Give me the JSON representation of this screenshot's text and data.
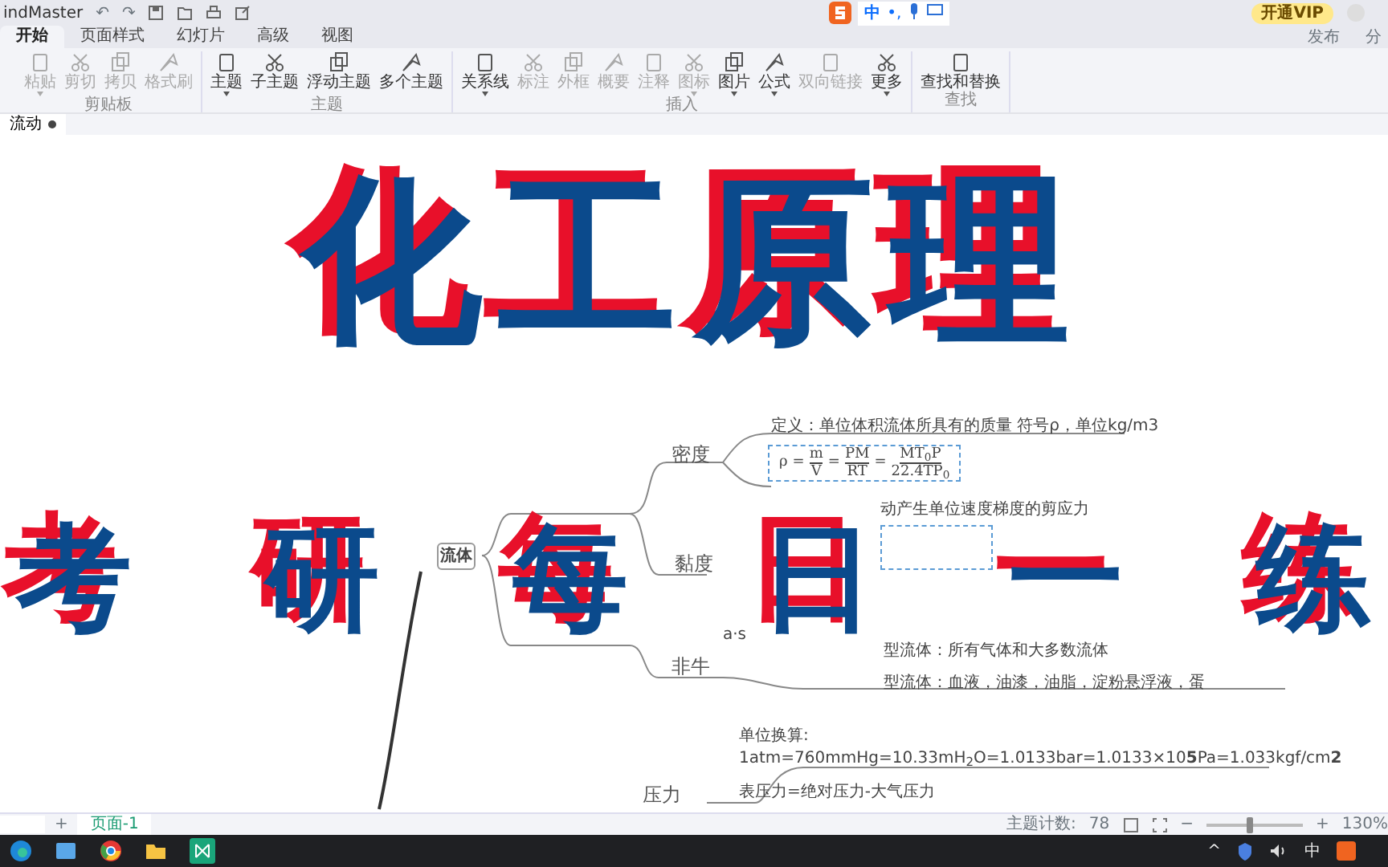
{
  "window": {
    "title": "indMaster",
    "quick_actions": [
      "↶",
      "↷"
    ]
  },
  "ime_bar": {
    "labels": [
      "中",
      "•,"
    ]
  },
  "account": {
    "vip": "开通VIP",
    "actions": [
      "发布",
      "分"
    ]
  },
  "tabs": [
    {
      "label": "开始",
      "selected": true
    },
    {
      "label": "页面样式",
      "selected": false
    },
    {
      "label": "幻灯片",
      "selected": false
    },
    {
      "label": "高级",
      "selected": false
    },
    {
      "label": "视图",
      "selected": false
    }
  ],
  "ribbon": [
    {
      "group": "剪贴板",
      "buttons": [
        {
          "label": "粘贴",
          "disabled": true,
          "dropdown": true
        },
        {
          "label": "剪切",
          "disabled": true,
          "dropdown": false
        },
        {
          "label": "拷贝",
          "disabled": true,
          "dropdown": false
        },
        {
          "label": "格式刷",
          "disabled": true,
          "dropdown": false
        }
      ]
    },
    {
      "group": "主题",
      "buttons": [
        {
          "label": "主题",
          "disabled": false,
          "dropdown": true
        },
        {
          "label": "子主题",
          "disabled": false,
          "dropdown": false
        },
        {
          "label": "浮动主题",
          "disabled": false,
          "dropdown": false
        },
        {
          "label": "多个主题",
          "disabled": false,
          "dropdown": false
        }
      ]
    },
    {
      "group": "插入",
      "buttons": [
        {
          "label": "关系线",
          "disabled": false,
          "dropdown": true
        },
        {
          "label": "标注",
          "disabled": true,
          "dropdown": false
        },
        {
          "label": "外框",
          "disabled": true,
          "dropdown": false
        },
        {
          "label": "概要",
          "disabled": true,
          "dropdown": false
        },
        {
          "label": "注释",
          "disabled": true,
          "dropdown": false
        },
        {
          "label": "图标",
          "disabled": true,
          "dropdown": true
        },
        {
          "label": "图片",
          "disabled": false,
          "dropdown": true
        },
        {
          "label": "公式",
          "disabled": false,
          "dropdown": true
        },
        {
          "label": "双向链接",
          "disabled": true,
          "dropdown": false
        },
        {
          "label": "更多",
          "disabled": false,
          "dropdown": true
        }
      ]
    },
    {
      "group": "查找",
      "buttons": [
        {
          "label": "查找和替换",
          "disabled": false,
          "dropdown": false
        }
      ]
    }
  ],
  "document_tab": {
    "label": "流动",
    "unsaved": true
  },
  "overlay_title": {
    "lines": [
      "化工原理",
      "考研每日一练"
    ]
  },
  "mindmap": {
    "root": "流体",
    "branches": [
      {
        "label": "密度",
        "notes": [
          {
            "kind": "text",
            "text": "定义：单位体积流体所具有的质量 符号ρ，单位kg/m3"
          },
          {
            "kind": "formula",
            "terms": [
              {
                "text": "ρ"
              },
              {
                "text": "="
              },
              {
                "num": "m",
                "den": "V"
              },
              {
                "text": "="
              },
              {
                "num": "PM",
                "den": "RT"
              },
              {
                "text": "="
              },
              {
                "num": "MT$_{0}$P",
                "den": "22.4TP$_{0}$"
              }
            ]
          }
        ]
      },
      {
        "label": "黏度",
        "notes": [
          {
            "kind": "text",
            "text": "动产生单位速度梯度的剪应力"
          },
          {
            "kind": "box"
          },
          {
            "kind": "text",
            "text": "a·s"
          }
        ]
      },
      {
        "label": "非牛",
        "notes": [
          {
            "kind": "text",
            "text": "型流体：所有气体和大多数流体"
          },
          {
            "kind": "text",
            "text": "型流体：血液，油漆，油脂，淀粉悬浮液，蛋"
          }
        ]
      },
      {
        "label": "压力",
        "notes": [
          {
            "kind": "text",
            "text": "单位换算:"
          },
          {
            "kind": "text",
            "text": "1atm=760mmHg=10.33mH$_{2}$O=1.0133bar=1.0133×10**5**Pa=1.033kgf/cm**2**"
          },
          {
            "kind": "text",
            "text": "表压力=绝对压力-大气压力"
          }
        ]
      }
    ]
  },
  "bottom_bar": {
    "add": "+",
    "pages": [
      {
        "label": "页面-1",
        "selected": true
      }
    ],
    "topic_count_label": "主题计数:",
    "topic_count": "78",
    "zoom_minus": "−",
    "zoom_plus": "+",
    "zoom": "130%",
    "zoom_slider": {
      "level": 0.45
    }
  },
  "taskbar": {
    "tray": [
      "^",
      "中"
    ]
  }
}
